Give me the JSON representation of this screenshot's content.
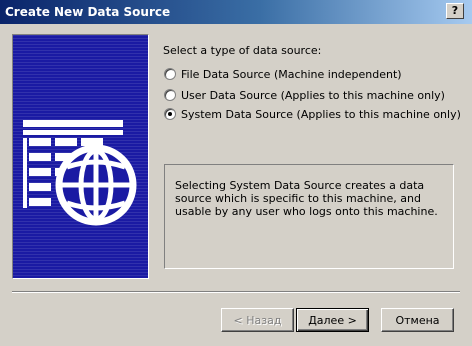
{
  "window": {
    "title": "Create New Data Source",
    "help_glyph": "?"
  },
  "prompt": "Select a type of data source:",
  "options": [
    {
      "label": "File Data Source (Machine independent)",
      "selected": false
    },
    {
      "label": "User Data Source (Applies to this machine only)",
      "selected": false
    },
    {
      "label": "System Data Source (Applies to this machine only)",
      "selected": true
    }
  ],
  "description": "Selecting System Data Source creates a data source which is specific to this machine, and usable by any user who logs onto this machine.",
  "buttons": {
    "back": "< Назад",
    "next": "Далее >",
    "cancel": "Отмена"
  },
  "icons": {
    "banner": "database-globe-icon",
    "help": "help-icon"
  },
  "colors": {
    "title_start": "#0a246a",
    "title_end": "#a6caf0",
    "banner_bg": "#1a1aa3",
    "face": "#d4d0c8"
  }
}
